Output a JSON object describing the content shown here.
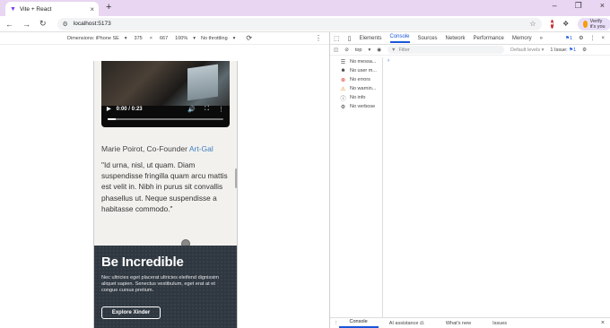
{
  "browser": {
    "tab_title": "Vite + React",
    "url": "localhost:5173",
    "profile_label": "Verify it's you"
  },
  "device_toolbar": {
    "dimensions_label": "Dimensions: iPhone SE",
    "width": "375",
    "times": "×",
    "height": "667",
    "zoom": "100%",
    "throttling": "No throttling"
  },
  "page": {
    "video_time": "0:00 / 0:23",
    "author_name": "Marie Poirot, Co-Founder",
    "author_company": "Art-Gal",
    "quote": "\"Id urna, nisl, ut quam. Diam suspendisse fringilla quam arcu mattis est velit in. Nibh in purus sit convallis phasellus ut. Neque suspendisse a habitasse commodo.\"",
    "promo_title": "Be Incredible",
    "promo_text": "Nec ultricies eget placerat ultricies eleifend dignissim aliquet sapien. Senectus vestibulum, eget erat at et congue cursus pretium.",
    "promo_button": "Explore Xinder"
  },
  "devtools": {
    "tabs": [
      "Elements",
      "Console",
      "Sources",
      "Network",
      "Performance",
      "Memory"
    ],
    "active_tab": "Console",
    "issues_badge": "1",
    "context": "top",
    "filter_placeholder": "Filter",
    "levels": "Default levels",
    "issues_count": "1 Issue:",
    "issues_count_num": "1",
    "sidebar": [
      {
        "label": "No messa...",
        "icon": "list-icon"
      },
      {
        "label": "No user m...",
        "icon": "user-icon"
      },
      {
        "label": "No errors",
        "icon": "error-icon"
      },
      {
        "label": "No warnin...",
        "icon": "warning-icon"
      },
      {
        "label": "No info",
        "icon": "info-icon"
      },
      {
        "label": "No verbose",
        "icon": "bug-icon"
      }
    ],
    "drawer_tabs": [
      "Console",
      "AI assistance",
      "What's new",
      "Issues"
    ]
  },
  "colors": {
    "accent": "#1a56db",
    "tab_strip": "#e9d6f2",
    "promo_bg": "#2f3740",
    "link": "#3d7fc0"
  }
}
